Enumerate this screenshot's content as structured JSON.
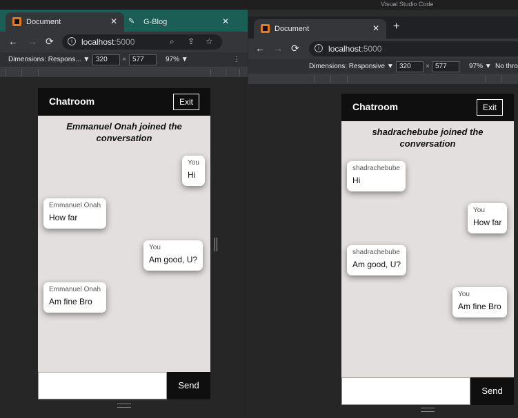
{
  "system": {
    "vs_title": "Visual Studio Code"
  },
  "left_window": {
    "tabs": [
      {
        "title": "Document",
        "close": "✕"
      },
      {
        "title": "G-Blog",
        "close": "✕"
      }
    ],
    "address": {
      "host": "localhost",
      "port": ":5000"
    },
    "devtools": {
      "dimensions_label": "Dimensions: Respons... ▼",
      "width": "320",
      "times": "×",
      "height": "577",
      "zoom": "97% ▼"
    },
    "chat": {
      "title": "Chatroom",
      "exit_label": "Exit",
      "join_notice": "Emmanuel Onah joined the conversation",
      "messages": [
        {
          "sender": "You",
          "text": "Hi"
        },
        {
          "sender": "Emmanuel Onah",
          "text": "How far"
        },
        {
          "sender": "You",
          "text": "Am good, U?"
        },
        {
          "sender": "Emmanuel Onah",
          "text": "Am fine Bro"
        }
      ],
      "input_value": "",
      "send_label": "Send"
    }
  },
  "right_window": {
    "tabs": [
      {
        "title": "Document",
        "close": "✕"
      }
    ],
    "newtab": "+",
    "address": {
      "host": "localhost",
      "port": ":5000"
    },
    "devtools": {
      "dimensions_label": "Dimensions: Responsive ▼",
      "width": "320",
      "times": "×",
      "height": "577",
      "zoom": "97% ▼",
      "throttle": "No thro"
    },
    "chat": {
      "title": "Chatroom",
      "exit_label": "Exit",
      "join_notice": "shadrachebube joined the conversation",
      "messages": [
        {
          "sender": "shadrachebube",
          "text": "Hi"
        },
        {
          "sender": "You",
          "text": "How far"
        },
        {
          "sender": "shadrachebube",
          "text": "Am good, U?"
        },
        {
          "sender": "You",
          "text": "Am fine Bro"
        }
      ],
      "input_value": "",
      "send_label": "Send"
    }
  },
  "icons": {
    "back": "←",
    "forward": "→",
    "reload": "⟳",
    "more": "⋮",
    "zoom": "⌕",
    "share": "⇪",
    "star": "☆"
  }
}
